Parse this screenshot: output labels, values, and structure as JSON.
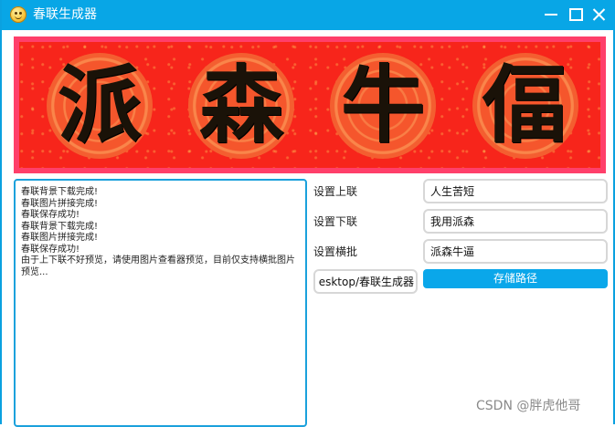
{
  "window": {
    "title": "春联生成器"
  },
  "banner": {
    "characters": [
      "派",
      "森",
      "牛",
      "偪"
    ],
    "frame_color": "#ff3f6a",
    "paper_color": "#f7251b"
  },
  "log": {
    "lines": [
      "春联背景下载完成!",
      "春联图片拼接完成!",
      "春联保存成功!",
      "春联背景下载完成!",
      "春联图片拼接完成!",
      "春联保存成功!",
      "由于上下联不好预览，请使用图片查看器预览，目前仅支持横批图片预览..."
    ]
  },
  "settings": {
    "upper_label": "设置上联",
    "upper_value": "人生苦短",
    "lower_label": "设置下联",
    "lower_value": "我用派森",
    "cross_label": "设置横批",
    "cross_value": "派森牛逼",
    "path_value": "esktop/春联生成器",
    "store_button": "存储路径"
  },
  "watermark": "CSDN @胖虎他哥",
  "colors": {
    "titlebar": "#08a6e6",
    "accent": "#0aa7ea"
  }
}
